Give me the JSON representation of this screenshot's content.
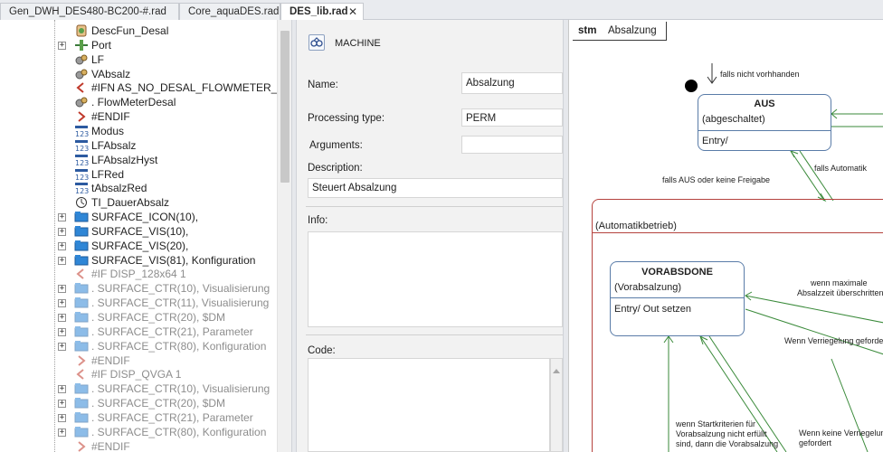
{
  "tabs": [
    {
      "label": "Gen_DWH_DES480-BC200-#.rad",
      "active": false
    },
    {
      "label": "Core_aquaDES.rad",
      "active": false
    },
    {
      "label": "DES_lib.rad",
      "active": true
    }
  ],
  "tab_close_glyph": "✕",
  "tree": {
    "rows": [
      {
        "text": "DescFun_Desal",
        "icon": "descfun-icon",
        "dim": false,
        "expandable": false
      },
      {
        "text": "Port",
        "icon": "port-icon",
        "dim": false,
        "expandable": true
      },
      {
        "text": "LF",
        "icon": "variable-gear-icon",
        "dim": false,
        "expandable": false
      },
      {
        "text": "VAbsalz",
        "icon": "variable-gear-icon",
        "dim": false,
        "expandable": false
      },
      {
        "text": "#IFN AS_NO_DESAL_FLOWMETER_N",
        "icon": "if-directive-icon",
        "dim": false,
        "expandable": false
      },
      {
        "text": ". FlowMeterDesal",
        "icon": "variable-gear-icon",
        "dim": false,
        "expandable": false
      },
      {
        "text": "#ENDIF",
        "icon": "endif-directive-icon",
        "dim": false,
        "expandable": false
      },
      {
        "text": "Modus",
        "icon": "numeric-123-icon",
        "dim": false,
        "expandable": false
      },
      {
        "text": "LFAbsalz",
        "icon": "numeric-123-icon",
        "dim": false,
        "expandable": false
      },
      {
        "text": "LFAbsalzHyst",
        "icon": "numeric-123-icon",
        "dim": false,
        "expandable": false
      },
      {
        "text": "LFRed",
        "icon": "numeric-123-icon",
        "dim": false,
        "expandable": false
      },
      {
        "text": "tAbsalzRed",
        "icon": "numeric-123-icon",
        "dim": false,
        "expandable": false
      },
      {
        "text": "TI_DauerAbsalz",
        "icon": "timer-icon",
        "dim": false,
        "expandable": false
      },
      {
        "text": "SURFACE_ICON(10),",
        "icon": "surface-icon",
        "dim": false,
        "expandable": true
      },
      {
        "text": "SURFACE_VIS(10),",
        "icon": "surface-icon",
        "dim": false,
        "expandable": true
      },
      {
        "text": "SURFACE_VIS(20),",
        "icon": "surface-icon",
        "dim": false,
        "expandable": true
      },
      {
        "text": "SURFACE_VIS(81), Konfiguration",
        "icon": "surface-icon",
        "dim": false,
        "expandable": true
      },
      {
        "text": "#IF DISP_128x64 1",
        "icon": "if-directive-icon",
        "dim": true,
        "expandable": false
      },
      {
        "text": ". SURFACE_CTR(10), Visualisierung",
        "icon": "surface-icon",
        "dim": true,
        "expandable": true
      },
      {
        "text": ". SURFACE_CTR(11), Visualisierung",
        "icon": "surface-icon",
        "dim": true,
        "expandable": true
      },
      {
        "text": ". SURFACE_CTR(20), $DM",
        "icon": "surface-icon",
        "dim": true,
        "expandable": true
      },
      {
        "text": ". SURFACE_CTR(21), Parameter",
        "icon": "surface-icon",
        "dim": true,
        "expandable": true
      },
      {
        "text": ". SURFACE_CTR(80), Konfiguration",
        "icon": "surface-icon",
        "dim": true,
        "expandable": true
      },
      {
        "text": "#ENDIF",
        "icon": "endif-directive-icon",
        "dim": true,
        "expandable": false
      },
      {
        "text": "#IF DISP_QVGA 1",
        "icon": "if-directive-icon",
        "dim": true,
        "expandable": false
      },
      {
        "text": ". SURFACE_CTR(10), Visualisierung",
        "icon": "surface-icon",
        "dim": true,
        "expandable": true
      },
      {
        "text": ". SURFACE_CTR(20), $DM",
        "icon": "surface-icon",
        "dim": true,
        "expandable": true
      },
      {
        "text": ". SURFACE_CTR(21), Parameter",
        "icon": "surface-icon",
        "dim": true,
        "expandable": true
      },
      {
        "text": ". SURFACE_CTR(80), Konfiguration",
        "icon": "surface-icon",
        "dim": true,
        "expandable": true
      },
      {
        "text": "#ENDIF",
        "icon": "endif-directive-icon",
        "dim": true,
        "expandable": false
      }
    ]
  },
  "properties": {
    "header_title": "MACHINE",
    "name_label": "Name:",
    "name_value": "Absalzung",
    "processing_label": "Processing type:",
    "processing_value": "PERM",
    "arguments_label": "Arguments:",
    "arguments_value": "",
    "description_label": "Description:",
    "description_value": "Steuert Absalzung",
    "info_label": "Info:",
    "code_label": "Code:"
  },
  "diagram": {
    "stm_label": "stm",
    "machine_name": "Absalzung",
    "states": {
      "aus": {
        "title": "AUS",
        "subtitle": "(abgeschaltet)",
        "entry": "Entry/"
      },
      "vorabsdone": {
        "title": "VORABSDONE",
        "subtitle": "(Vorabsalzung)",
        "entry": "Entry/ Out setzen"
      }
    },
    "composite_caption": "(Automatikbetrieb)",
    "transitions": {
      "initial": "falls nicht vorhhanden",
      "to_aus": "falls AUS oder keine Freigabe",
      "to_auto": "falls Automatik",
      "max_time": [
        "wenn maximale",
        "Absalzzeit überschritten"
      ],
      "locking_required": "Wenn Verriegelung gefordert",
      "start_criteria": [
        "wenn Startkriterien für",
        "Vorabsalzung nicht erfüllt",
        "sind, dann die Vorabsalzung"
      ],
      "no_locking": [
        "Wenn keine Verriegelung",
        "gefordert"
      ]
    }
  },
  "colors": {
    "state_border": "#5a7ca8",
    "composite_border": "#b5433e",
    "transition_green": "#3a8a3a",
    "tab_bar": "#e9ebef"
  }
}
